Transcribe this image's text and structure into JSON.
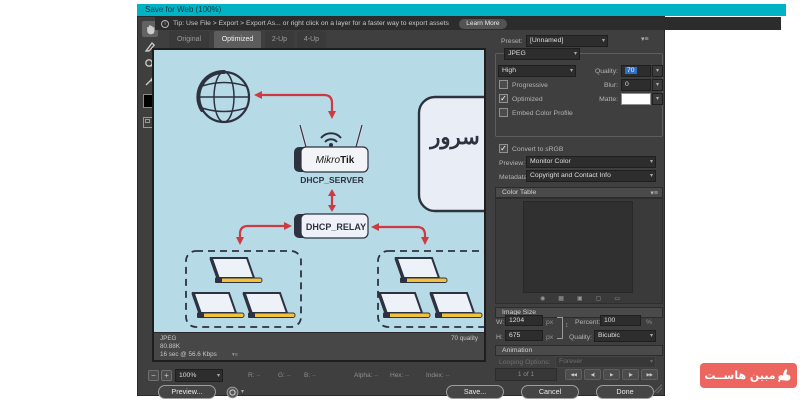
{
  "window": {
    "title": "Save for Web (100%)"
  },
  "tip": {
    "info": "i",
    "text": "Tip: Use File > Export > Export As...  or right click on a layer for a faster way to export assets",
    "learn_more": "Learn More"
  },
  "tabs": [
    {
      "label": "Original"
    },
    {
      "label": "Optimized"
    },
    {
      "label": "2-Up"
    },
    {
      "label": "4-Up"
    }
  ],
  "preview": {
    "status": {
      "format": "JPEG",
      "filesize": "80.88K",
      "download_time": "16 sec @ 56.6 Kbps",
      "quality_note": "70 quality"
    },
    "diagram": {
      "router_brand_regular": "Mikro",
      "router_brand_bold": "Tik",
      "server_label": "DHCP_SERVER",
      "relay_label": "DHCP_RELAY",
      "server_box_text": "سرور"
    }
  },
  "settings": {
    "preset_label": "Preset:",
    "preset_value": "[Unnamed]",
    "format_value": "JPEG",
    "compression_value": "High",
    "quality_label": "Quality:",
    "quality_value": "70",
    "progressive_label": "Progressive",
    "blur_label": "Blur:",
    "blur_value": "0",
    "optimized_label": "Optimized",
    "matte_label": "Matte:",
    "embed_label": "Embed Color Profile",
    "convert_label": "Convert to sRGB",
    "preview_label": "Preview:",
    "preview_value": "Monitor Color",
    "metadata_label": "Metadata:",
    "metadata_value": "Copyright and Contact Info"
  },
  "color_table": {
    "title": "Color Table"
  },
  "image_size": {
    "title": "Image Size",
    "w_label": "W:",
    "w_value": "1204",
    "h_label": "H:",
    "h_value": "675",
    "unit": "px",
    "percent_label": "Percent:",
    "percent_value": "100",
    "percent_unit": "%",
    "quality_label": "Quality:",
    "quality_value": "Bicubic"
  },
  "animation": {
    "title": "Animation",
    "looping_label": "Looping Options:",
    "looping_value": "Forever",
    "frame_indicator": "1 of 1"
  },
  "statusbar": {
    "zoom_level": "100%",
    "channels": [
      {
        "label": "R:",
        "value": "–"
      },
      {
        "label": "G:",
        "value": "–"
      },
      {
        "label": "B:",
        "value": "–"
      },
      {
        "label": "Alpha:",
        "value": "–"
      },
      {
        "label": "Hex:",
        "value": "–"
      },
      {
        "label": "Index:",
        "value": "–"
      }
    ]
  },
  "buttons": {
    "preview": "Preview...",
    "save": "Save...",
    "cancel": "Cancel",
    "done": "Done"
  },
  "watermark": {
    "text": "مبین هاســت"
  },
  "icons": {
    "chevron": "▾",
    "panel_menu": "▾≡",
    "check": "✓",
    "link_updown": "↕",
    "zoom_out": "−",
    "zoom_in": "+",
    "status_menu": "▾≡",
    "playback": {
      "first": "◀◀",
      "prev": "◀|",
      "play": "▶",
      "next": "|▶",
      "last": "▶▶"
    },
    "color_table_actions": [
      {
        "glyph": "◉"
      },
      {
        "glyph": "▦"
      },
      {
        "glyph": "▣"
      },
      {
        "glyph": "▢"
      },
      {
        "glyph": "▭"
      }
    ]
  },
  "colors": {
    "titlebar_teal": "#00b3c4",
    "canvas_blue": "#b6dbe7",
    "arrow_red": "#ce3a41",
    "diagram_navy": "#2e3140",
    "badge_red": "#ec655e",
    "selection_blue": "#2f6fc4",
    "laptop_yellow": "#f0c23e"
  }
}
